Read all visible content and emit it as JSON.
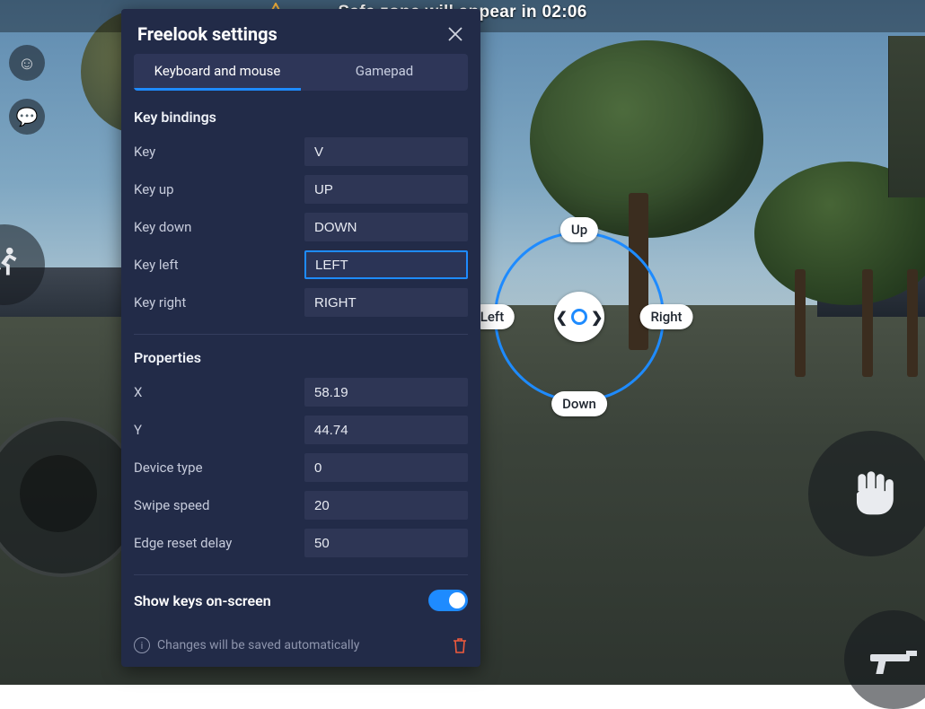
{
  "hud": {
    "top_text": "Safe zone will appear in 02:06"
  },
  "ring": {
    "up": "Up",
    "down": "Down",
    "left": "Left",
    "right": "Right"
  },
  "panel": {
    "title": "Freelook settings",
    "tabs": {
      "keyboard": "Keyboard and mouse",
      "gamepad": "Gamepad"
    },
    "sections": {
      "bindings": "Key bindings",
      "properties": "Properties"
    },
    "bindings": {
      "key_label": "Key",
      "key_value": "V",
      "key_up_label": "Key up",
      "key_up_value": "UP",
      "key_down_label": "Key down",
      "key_down_value": "DOWN",
      "key_left_label": "Key left",
      "key_left_value": "LEFT",
      "key_right_label": "Key right",
      "key_right_value": "RIGHT"
    },
    "properties": {
      "x_label": "X",
      "x_value": "58.19",
      "y_label": "Y",
      "y_value": "44.74",
      "device_label": "Device type",
      "device_value": "0",
      "swipe_label": "Swipe speed",
      "swipe_value": "20",
      "edge_label": "Edge reset delay",
      "edge_value": "50"
    },
    "show_keys_label": "Show keys on-screen",
    "show_keys_on": true,
    "footer_msg": "Changes will be saved automatically"
  }
}
